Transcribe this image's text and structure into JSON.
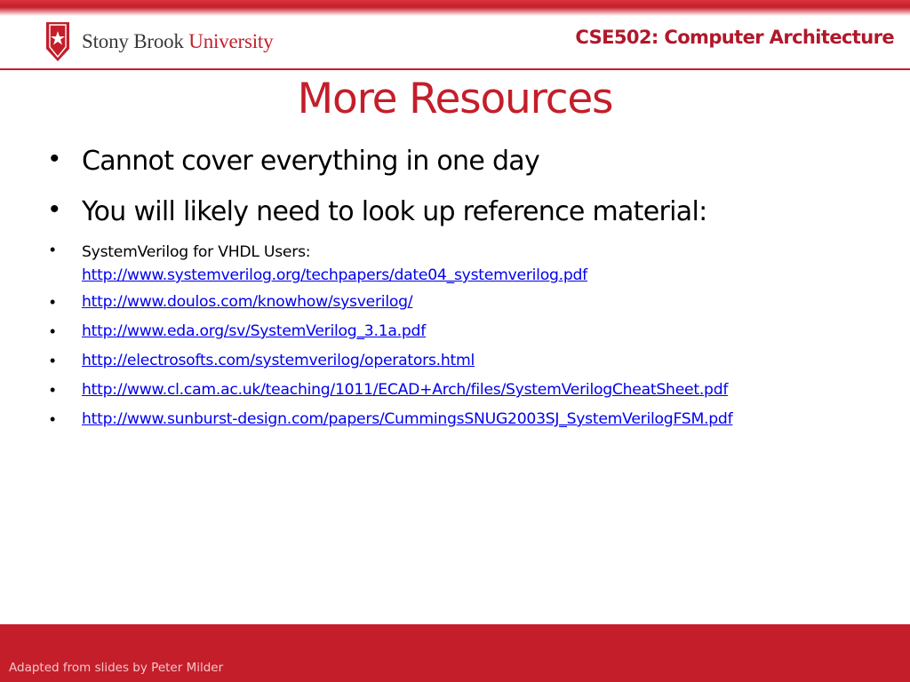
{
  "header": {
    "logo_text": "Stony Brook",
    "logo_text_university": "University",
    "course": "CSE502: Computer Architecture"
  },
  "slide": {
    "title": "More Resources",
    "bullets": [
      "Cannot cover everything in one day",
      "You will likely need to look up reference material:"
    ],
    "resources": [
      {
        "label": "SystemVerilog for VHDL Users:",
        "url": "http://www.systemverilog.org/techpapers/date04_systemverilog.pdf"
      },
      {
        "label": "",
        "url": "http://www.doulos.com/knowhow/sysverilog/"
      },
      {
        "label": "",
        "url": "http://www.eda.org/sv/SystemVerilog_3.1a.pdf"
      },
      {
        "label": "",
        "url": "http://electrosofts.com/systemverilog/operators.html"
      },
      {
        "label": "",
        "url": "http://www.cl.cam.ac.uk/teaching/1011/ECAD+Arch/files/SystemVerilogCheatSheet.pdf"
      },
      {
        "label": "",
        "url": "http://www.sunburst-design.com/papers/CummingsSNUG2003SJ_SystemVerilogFSM.pdf"
      }
    ]
  },
  "footer": {
    "credit": "Adapted from slides by Peter Milder"
  },
  "colors": {
    "brand_red": "#c41e2a",
    "link_blue": "#0000ee"
  }
}
